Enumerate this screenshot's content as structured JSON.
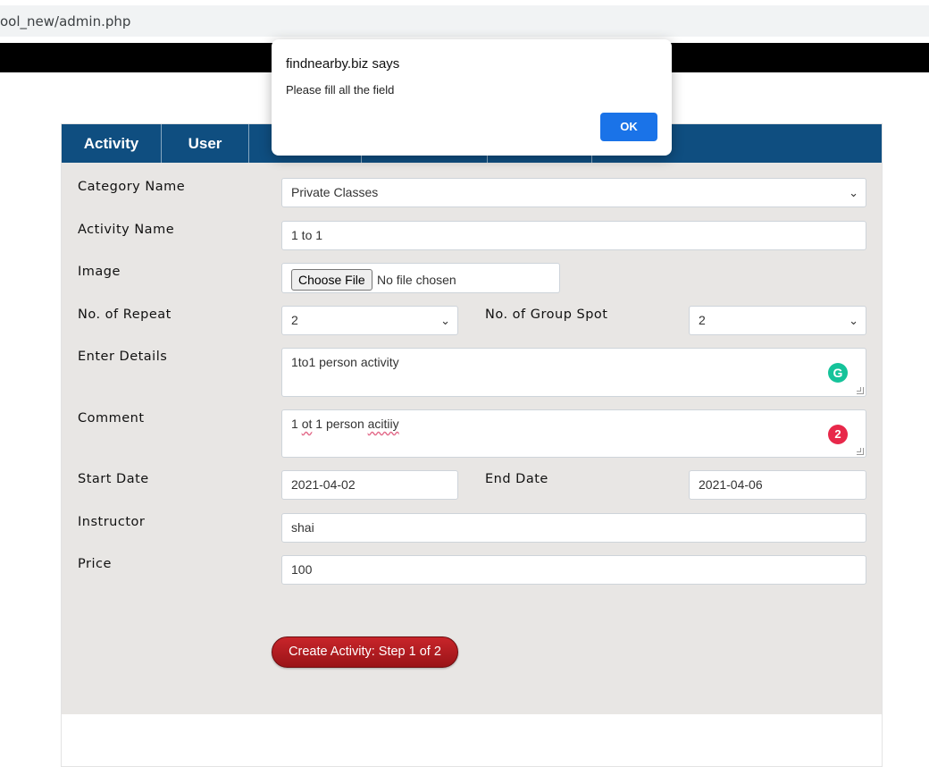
{
  "browser": {
    "url": "ool_new/admin.php"
  },
  "tabs": [
    "Activity",
    "User",
    "",
    "",
    "",
    ""
  ],
  "form": {
    "category_label": "Category Name",
    "category_value": "Private Classes",
    "activity_name_label": "Activity Name",
    "activity_name_value": "1 to 1",
    "image_label": "Image",
    "file_button": "Choose File",
    "file_status": "No file chosen",
    "repeat_label": "No. of Repeat",
    "repeat_value": "2",
    "group_spot_label": "No. of Group Spot",
    "group_spot_value": "2",
    "details_label": "Enter Details",
    "details_value": "1to1 person activity",
    "comment_label": "Comment",
    "comment_words": [
      "1 ",
      "ot",
      " 1 person ",
      "acitiiy"
    ],
    "comment_error_count": "2",
    "start_label": "Start Date",
    "start_value": "2021-04-02",
    "end_label": "End Date",
    "end_value": "2021-04-06",
    "instructor_label": "Instructor",
    "instructor_value": "shai",
    "price_label": "Price",
    "price_value": "100",
    "submit_label": "Create Activity: Step 1 of 2"
  },
  "dialog": {
    "title": "findnearby.biz says",
    "message": "Please fill all the field",
    "ok_label": "OK"
  },
  "icons": {
    "select_arrow": "chevron-down-icon",
    "grammarly": "grammarly-icon",
    "grammarly_glyph": "G"
  }
}
